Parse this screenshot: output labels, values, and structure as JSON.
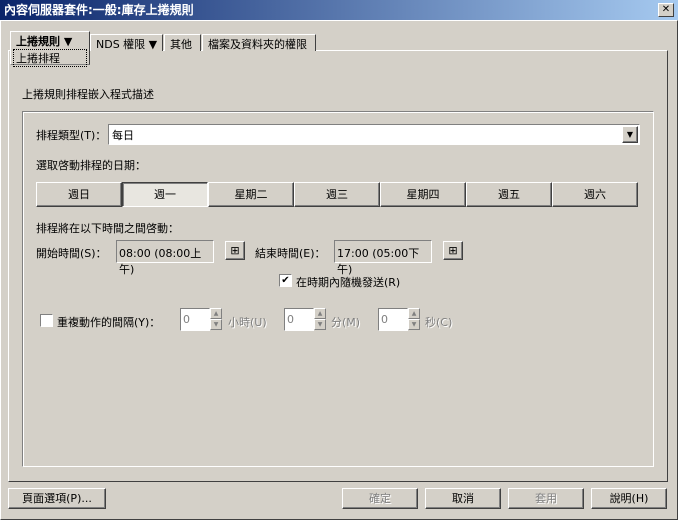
{
  "window": {
    "title": "內容伺服器套件:一般:庫存上捲規則",
    "close": "✕"
  },
  "tabs": [
    {
      "label": "上捲規則 ▼",
      "sub": "上捲排程"
    },
    {
      "label": "NDS 權限 ▼"
    },
    {
      "label": "其他"
    },
    {
      "label": "檔案及資料夾的權限"
    }
  ],
  "section_title": "上捲規則排程嵌入程式描述",
  "schedule_type": {
    "label": "排程類型(T)：",
    "value": "每日"
  },
  "day_prompt": "選取啓動排程的日期：",
  "days": [
    "週日",
    "週一",
    "星期二",
    "週三",
    "星期四",
    "週五",
    "週六"
  ],
  "selected_day": "週一",
  "time_prompt": "排程將在以下時間之間啓動：",
  "start": {
    "label": "開始時間(S)：",
    "value": "08:00 (08:00上午)"
  },
  "end": {
    "label": "結束時間(E)：",
    "value": "17:00 (05:00下午)"
  },
  "random": {
    "label": "在時期內隨機發送(R)",
    "checked": true
  },
  "repeat": {
    "label": "重複動作的間隔(Y)：",
    "checked": false,
    "hours": "0",
    "hours_label": "小時(U)",
    "minutes": "0",
    "minutes_label": "分(M)",
    "seconds": "0",
    "seconds_label": "秒(C)"
  },
  "buttons": {
    "page_options": "頁面選項(P)...",
    "ok": "確定",
    "cancel": "取消",
    "apply": "套用",
    "help": "說明(H)"
  }
}
